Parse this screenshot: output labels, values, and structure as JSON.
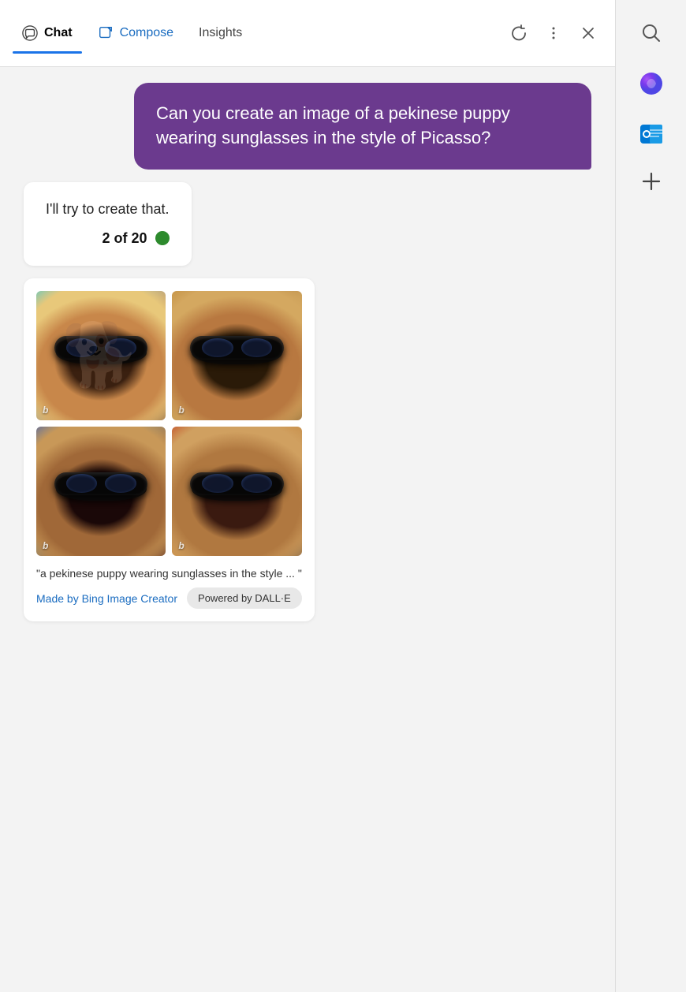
{
  "tabs": {
    "chat": {
      "label": "Chat",
      "active": true
    },
    "compose": {
      "label": "Compose"
    },
    "insights": {
      "label": "Insights"
    }
  },
  "user_message": {
    "text": "Can you create an image of a pekinese puppy wearing sunglasses in the style of Picasso?"
  },
  "ai_response": {
    "text": "I'll try to create that.",
    "usage": "2 of 20"
  },
  "image_results": {
    "caption": "\"a pekinese puppy wearing sunglasses in the style ... \"",
    "made_by_label": "Made by Bing Image Creator",
    "powered_by_label": "Powered by DALL·E",
    "images": [
      {
        "id": 1,
        "alt": "Pekinese puppy in Picasso style top-left"
      },
      {
        "id": 2,
        "alt": "Pekinese puppy in Picasso style top-right"
      },
      {
        "id": 3,
        "alt": "Pekinese puppy in Picasso style bottom-left"
      },
      {
        "id": 4,
        "alt": "Pekinese puppy in Picasso style bottom-right"
      }
    ]
  },
  "sidebar": {
    "icons": [
      {
        "name": "search",
        "symbol": "🔍"
      },
      {
        "name": "copilot",
        "symbol": "🟣"
      },
      {
        "name": "outlook",
        "symbol": "📧"
      },
      {
        "name": "add",
        "symbol": "+"
      }
    ]
  },
  "colors": {
    "user_bubble": "#6b3a8e",
    "active_tab_underline": "#1a73e8",
    "usage_dot": "#2d8a2d"
  }
}
